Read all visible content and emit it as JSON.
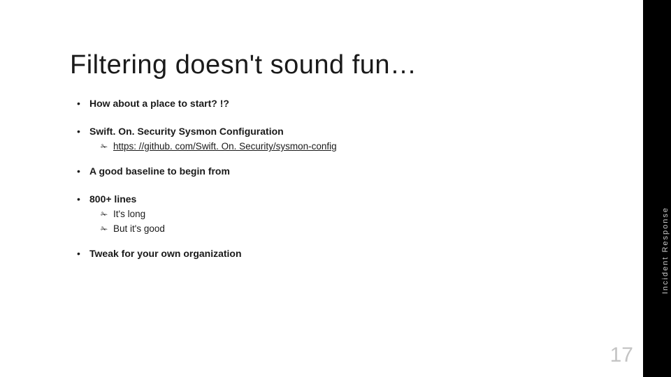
{
  "title": "Filtering doesn't sound fun…",
  "sidebar_label": "Incident Response",
  "page_number": "17",
  "bullets": {
    "b1": "How about a place to start? !?",
    "b2": "Swift. On. Security Sysmon Configuration",
    "b2_link_icon": "✁",
    "b2_link": "https: //github. com/Swift. On. Security/sysmon-config",
    "b3": "A good baseline to begin from",
    "b4": "800+ lines",
    "b4_sub1_icon": "✁",
    "b4_sub1": "It's long",
    "b4_sub2_icon": "✁",
    "b4_sub2": "But it's good",
    "b5": "Tweak for your own organization"
  }
}
